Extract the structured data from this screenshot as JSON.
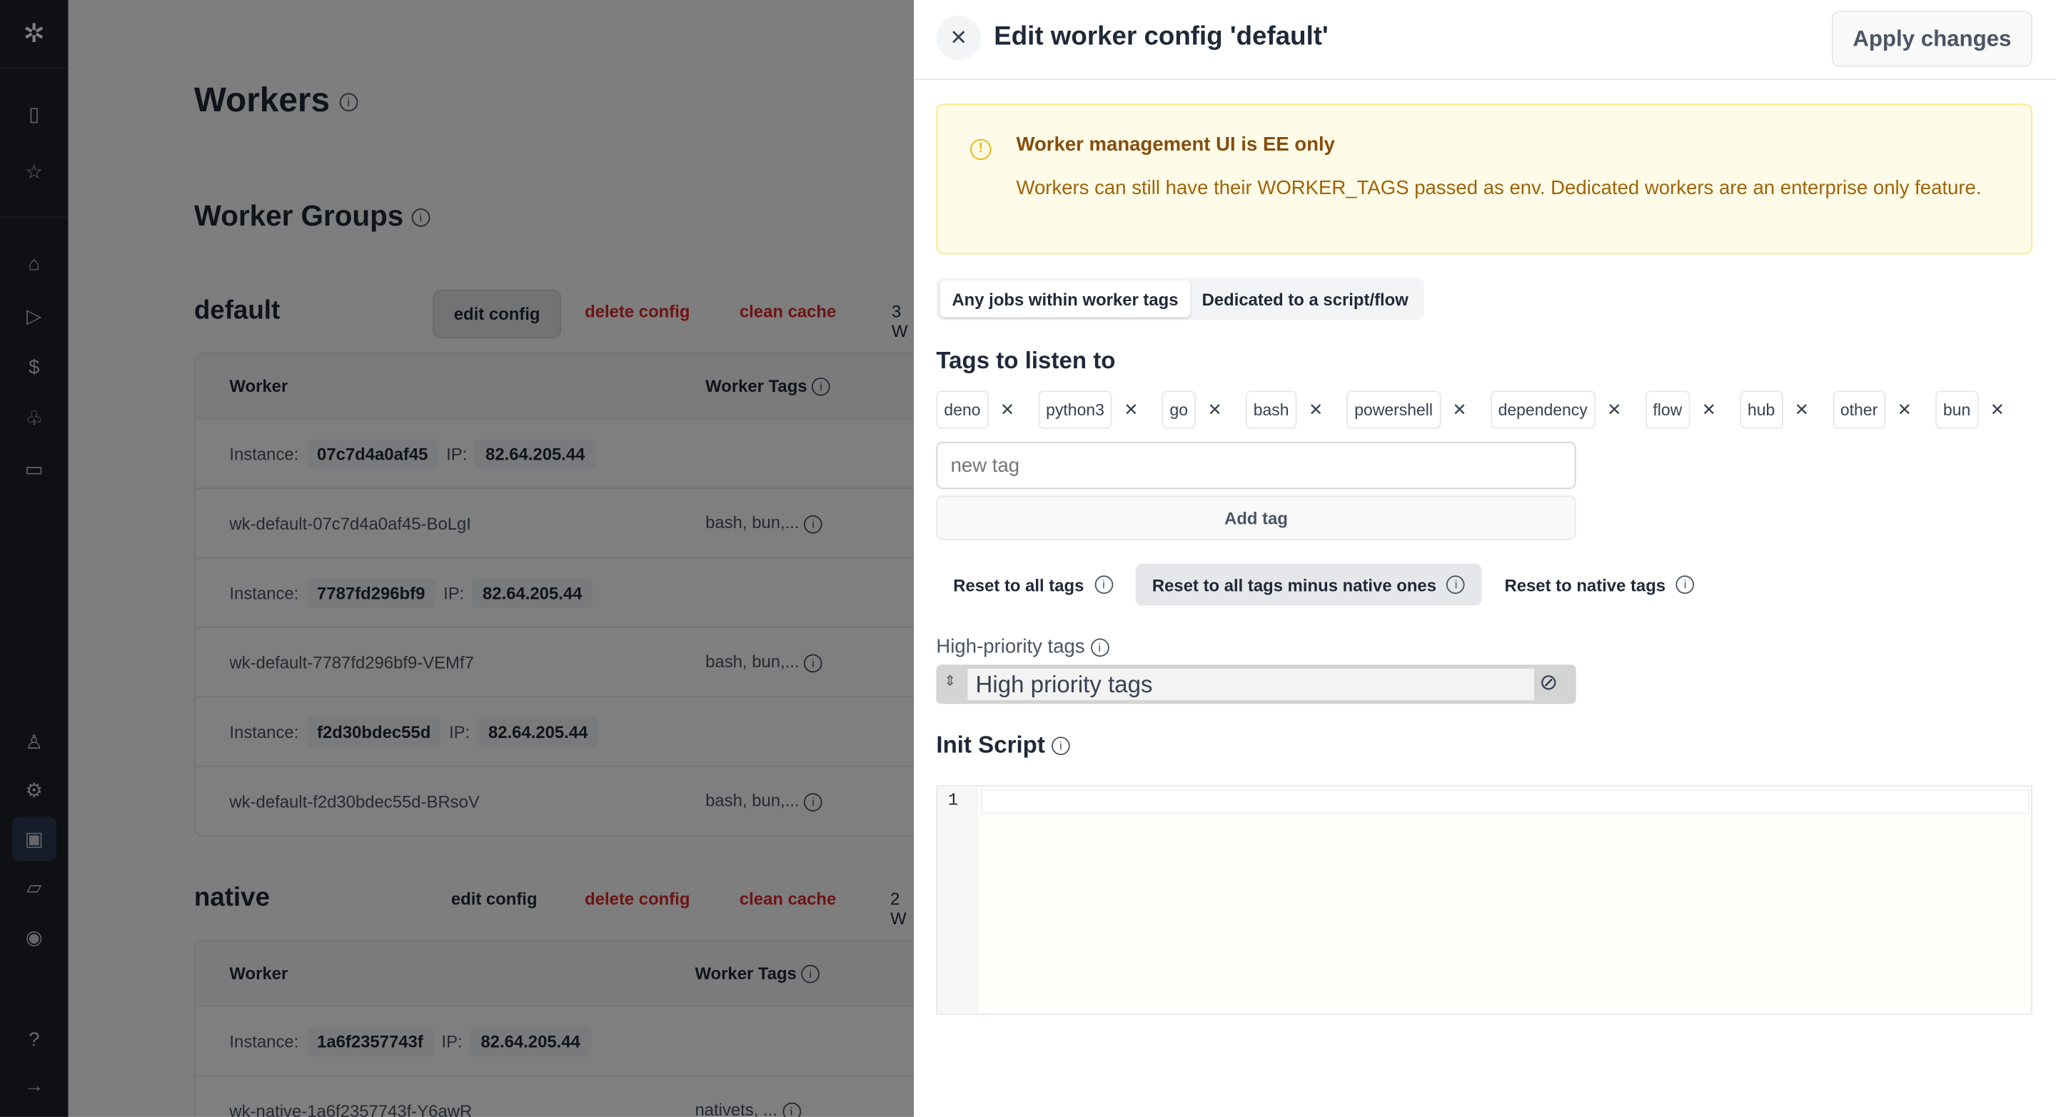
{
  "sidebar": {
    "items": [
      "logo",
      "building-icon",
      "star-icon",
      "home-icon",
      "play-icon",
      "dollar-icon",
      "resources-icon",
      "calendar-icon",
      "user-icon",
      "gear-icon",
      "workers-icon",
      "folder-icon",
      "eye-icon",
      "help-icon",
      "arrow-right-icon"
    ],
    "active": "workers"
  },
  "main": {
    "title": "Workers",
    "groups_title": "Worker Groups",
    "groups": [
      {
        "name": "default",
        "edit": "edit config",
        "delete": "delete config",
        "clean": "clean cache",
        "count": "3 W",
        "headers": {
          "worker": "Worker",
          "tags": "Worker Tags"
        },
        "rows": [
          {
            "instance_label": "Instance:",
            "instance": "07c7d4a0af45",
            "ip_label": "IP:",
            "ip": "82.64.205.44"
          },
          {
            "worker": "wk-default-07c7d4a0af45-BoLgI",
            "tags": "bash, bun,..."
          },
          {
            "instance_label": "Instance:",
            "instance": "7787fd296bf9",
            "ip_label": "IP:",
            "ip": "82.64.205.44"
          },
          {
            "worker": "wk-default-7787fd296bf9-VEMf7",
            "tags": "bash, bun,..."
          },
          {
            "instance_label": "Instance:",
            "instance": "f2d30bdec55d",
            "ip_label": "IP:",
            "ip": "82.64.205.44"
          },
          {
            "worker": "wk-default-f2d30bdec55d-BRsoV",
            "tags": "bash, bun,..."
          }
        ]
      },
      {
        "name": "native",
        "edit": "edit config",
        "delete": "delete config",
        "clean": "clean cache",
        "count": "2 W",
        "headers": {
          "worker": "Worker",
          "tags": "Worker Tags"
        },
        "rows": [
          {
            "instance_label": "Instance:",
            "instance": "1a6f2357743f",
            "ip_label": "IP:",
            "ip": "82.64.205.44"
          },
          {
            "worker": "wk-native-1a6f2357743f-Y6awR",
            "tags": "nativets, ..."
          }
        ]
      }
    ]
  },
  "drawer": {
    "title": "Edit worker config 'default'",
    "apply": "Apply changes",
    "alert": {
      "title": "Worker management UI is EE only",
      "body": "Workers can still have their WORKER_TAGS passed as env. Dedicated workers are an enterprise only feature."
    },
    "modes": [
      "Any jobs within worker tags",
      "Dedicated to a script/flow"
    ],
    "selected_mode": "Any jobs within worker tags",
    "tags_title": "Tags to listen to",
    "tags": [
      "deno",
      "python3",
      "go",
      "bash",
      "powershell",
      "dependency",
      "flow",
      "hub",
      "other",
      "bun"
    ],
    "new_tag_placeholder": "new tag",
    "add_tag": "Add tag",
    "reset": [
      "Reset to all tags",
      "Reset to all tags minus native ones",
      "Reset to native tags"
    ],
    "high_priority_label": "High-priority tags",
    "high_priority_placeholder": "High priority tags",
    "init_script_title": "Init Script",
    "editor_line": "1"
  },
  "colors": {
    "alert_bg": "#fefce8",
    "alert_text": "#854d0e",
    "danger": "#dc2626",
    "sidebar": "#1f2127"
  }
}
